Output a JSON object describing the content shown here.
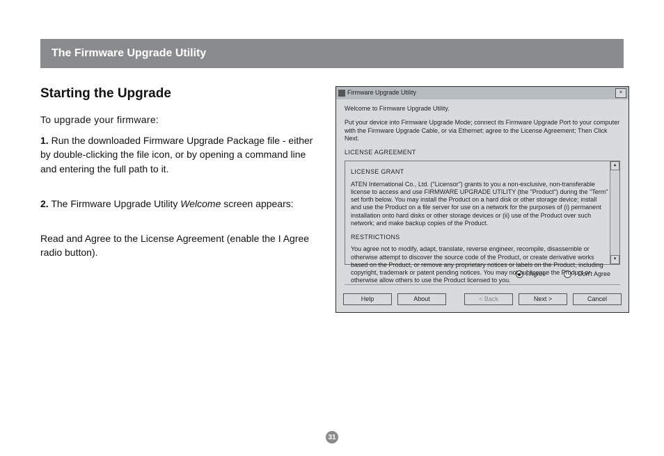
{
  "header": "The Firmware Upgrade Utility",
  "section_title": "Starting the Upgrade",
  "intro": "To upgrade your firmware:",
  "step1_num": "1.",
  "step1_text": " Run the downloaded Firmware Upgrade Package file - either by double-clicking the file icon, or by opening a command line and entering the full path to it.",
  "step2_num": "2.",
  "step2_pre": " The Firmware Upgrade Utility ",
  "step2_ital": "Welcome",
  "step2_post": " screen appears:",
  "step2_sub_pre": "Read and ",
  "step2_sub_ital": "Agree",
  "step2_sub_post": " to the License Agreement (enable the I Agree radio button).",
  "dialog": {
    "title": "Firmware Upgrade Utility",
    "welcome": "Welcome to Firmware Upgrade Utility.",
    "instruction": "Put your device into Firmware Upgrade Mode; connect its Firmware Upgrade Port to your computer with the Firmware Upgrade Cable, or via Ethernet; agree to the License Agreement; Then Click Next.",
    "license_heading": "LICENSE AGREEMENT",
    "grant_heading": "LICENSE GRANT",
    "grant_text": "ATEN International Co., Ltd. (\"Licensor\") grants to you a non-exclusive, non-transferable license to access and use FIRMWARE UPGRADE UTILITY (the \"Product\") during the \"Term\" set forth below. You may install the Product on a hard disk or other storage device; install and use the Product on a file server for use on a network for the purposes of (i) permanent installation onto hard disks or other storage devices or (ii) use of the Product over such network; and make backup copies of the Product.",
    "restrict_heading": "RESTRICTIONS",
    "restrict_text": "You agree not to modify, adapt, translate, reverse engineer, recompile, disassemble or otherwise attempt to discover the source code of the Product, or create derivative works based on the Product, or remove any proprietary notices or labels on the Product, including copyright, trademark or patent pending notices. You may not sublicense the Product or otherwise allow others to use the Product licensed to you.",
    "agree": "I Agree",
    "dont_agree": "I Don't Agree",
    "buttons": {
      "help": "Help",
      "about": "About",
      "back": "< Back",
      "next": "Next >",
      "cancel": "Cancel"
    }
  },
  "page_number": "31"
}
